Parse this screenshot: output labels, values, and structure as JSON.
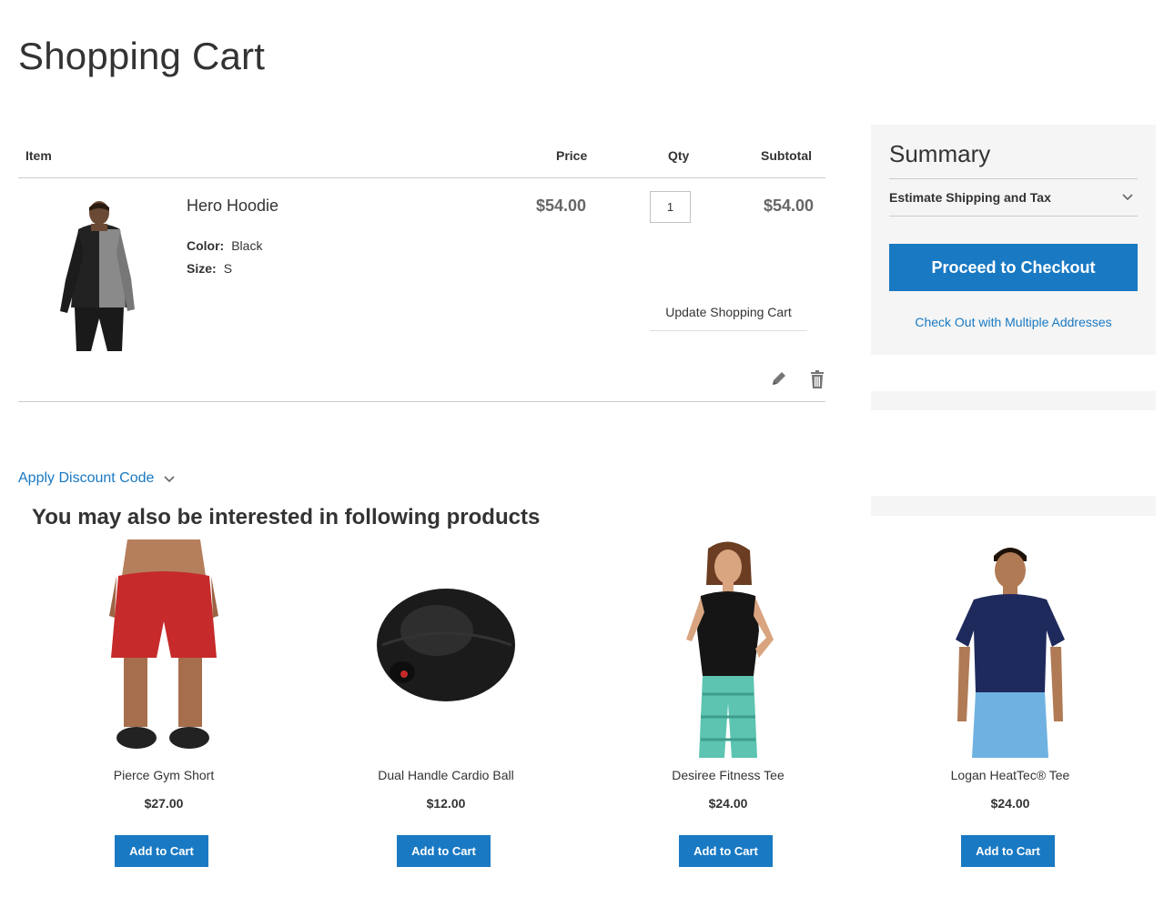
{
  "page": {
    "title": "Shopping Cart"
  },
  "cart": {
    "headers": {
      "item": "Item",
      "price": "Price",
      "qty": "Qty",
      "subtotal": "Subtotal"
    },
    "items": [
      {
        "name": "Hero Hoodie",
        "options": [
          {
            "label": "Color:",
            "value": "Black"
          },
          {
            "label": "Size:",
            "value": "S"
          }
        ],
        "price": "$54.00",
        "qty": "1",
        "subtotal": "$54.00"
      }
    ],
    "update_label": "Update Shopping Cart",
    "discount_label": "Apply Discount Code"
  },
  "summary": {
    "title": "Summary",
    "shipping_label": "Estimate Shipping and Tax",
    "checkout_label": "Proceed to Checkout",
    "multi_label": "Check Out with Multiple Addresses"
  },
  "related": {
    "title": "You may also be interested in following products",
    "products": [
      {
        "name": "Pierce Gym Short",
        "price": "$27.00",
        "button": "Add to Cart"
      },
      {
        "name": "Dual Handle Cardio Ball",
        "price": "$12.00",
        "button": "Add to Cart"
      },
      {
        "name": "Desiree Fitness Tee",
        "price": "$24.00",
        "button": "Add to Cart"
      },
      {
        "name": "Logan HeatTec® Tee",
        "price": "$24.00",
        "button": "Add to Cart"
      }
    ]
  },
  "colors": {
    "accent": "#1979c3",
    "panel": "#f5f5f5",
    "text": "#333333"
  }
}
